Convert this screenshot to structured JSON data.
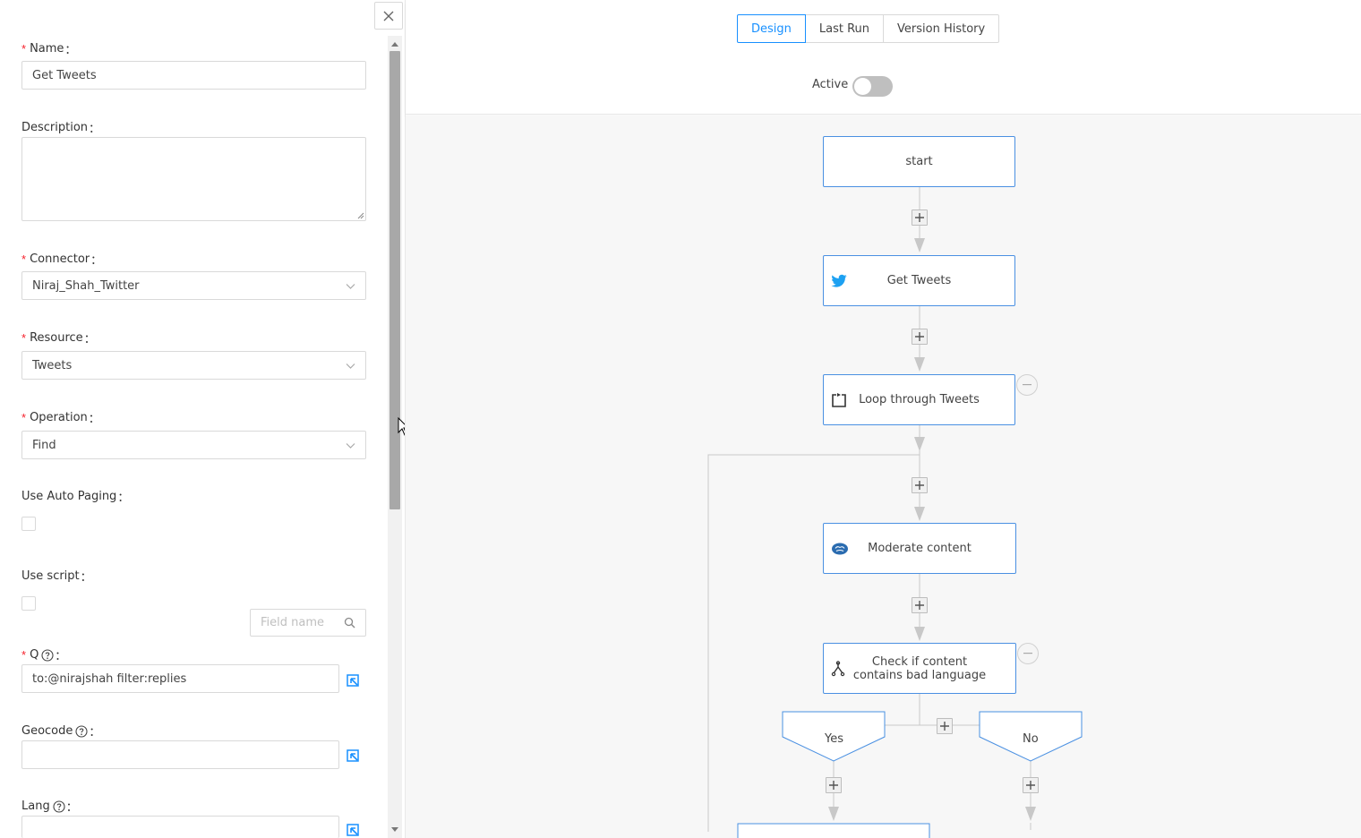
{
  "form": {
    "name": {
      "label": "Name",
      "value": "Get Tweets"
    },
    "description": {
      "label": "Description",
      "value": ""
    },
    "connector": {
      "label": "Connector",
      "value": "Niraj_Shah_Twitter"
    },
    "resource": {
      "label": "Resource",
      "value": "Tweets"
    },
    "operation": {
      "label": "Operation",
      "value": "Find"
    },
    "auto_paging": {
      "label": "Use Auto Paging"
    },
    "use_script": {
      "label": "Use script"
    },
    "field_search": {
      "placeholder": "Field name"
    },
    "q": {
      "label": "Q",
      "value": "to:@nirajshah filter:replies"
    },
    "geocode": {
      "label": "Geocode",
      "value": ""
    },
    "lang": {
      "label": "Lang",
      "value": ""
    },
    "colon": "："
  },
  "header": {
    "tabs": [
      "Design",
      "Last Run",
      "Version History"
    ],
    "active_tab": "Design",
    "active_label": "Active",
    "active_on": false
  },
  "flow": {
    "nodes": {
      "start": "start",
      "get_tweets": "Get Tweets",
      "loop": "Loop through Tweets",
      "moderate": "Moderate content",
      "check_line1": "Check if content",
      "check_line2": "contains bad language"
    },
    "branches": {
      "yes": "Yes",
      "no": "No"
    }
  },
  "colors": {
    "accent": "#1890ff",
    "node_border": "#4a90e2",
    "required": "#f5222d",
    "twitter": "#1da1f2"
  }
}
